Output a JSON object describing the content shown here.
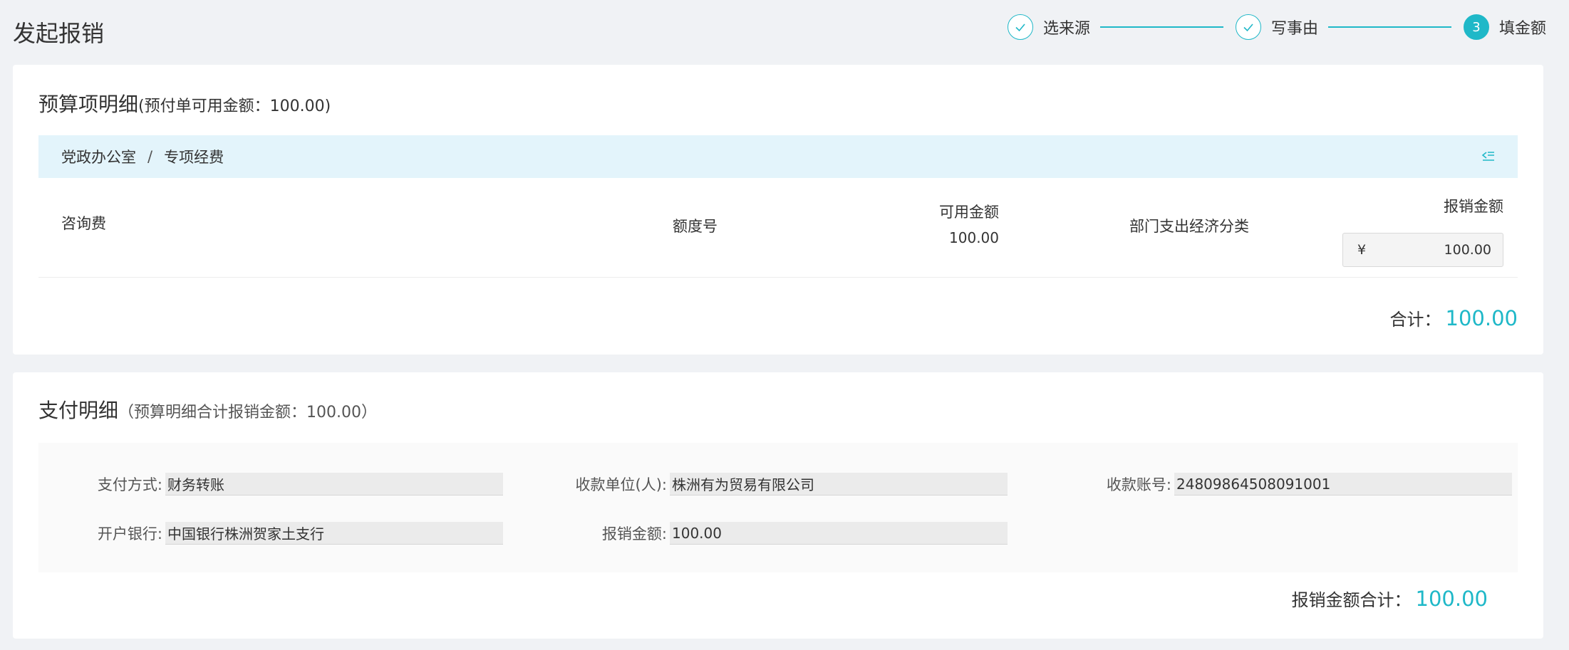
{
  "page": {
    "title": "发起报销"
  },
  "steps": [
    {
      "label": "选来源",
      "status": "done",
      "icon": "check-icon"
    },
    {
      "label": "写事由",
      "status": "done",
      "icon": "check-icon"
    },
    {
      "label": "填金额",
      "status": "active",
      "number": "3"
    }
  ],
  "colors": {
    "accent": "#1fb8c8",
    "crumb_bg": "#e3f4fb"
  },
  "budget": {
    "title": "预算项明细",
    "subtitle": "(预付单可用金额：100.00)",
    "breadcrumb": [
      "党政办公室",
      "专项经费"
    ],
    "breadcrumb_sep": "/",
    "row": {
      "name": "咨询费",
      "quota_label": "额度号",
      "available_label": "可用金额",
      "available_value": "100.00",
      "category_label": "部门支出经济分类",
      "reimburse_label": "报销金额",
      "currency": "¥",
      "reimburse_value": "100.00"
    },
    "total_label": "合计：",
    "total_value": "100.00"
  },
  "payment": {
    "title": "支付明细",
    "subtitle": "（预算明细合计报销金额：100.00）",
    "fields": {
      "method_label": "支付方式:",
      "method_value": "财务转账",
      "payee_label": "收款单位(人):",
      "payee_value": "株洲有为贸易有限公司",
      "account_label": "收款账号:",
      "account_value": "24809864508091001",
      "bank_label": "开户银行:",
      "bank_value": "中国银行株洲贺家土支行",
      "amount_label": "报销金额:",
      "amount_value": "100.00"
    },
    "total_label": "报销金额合计：",
    "total_value": "100.00"
  }
}
